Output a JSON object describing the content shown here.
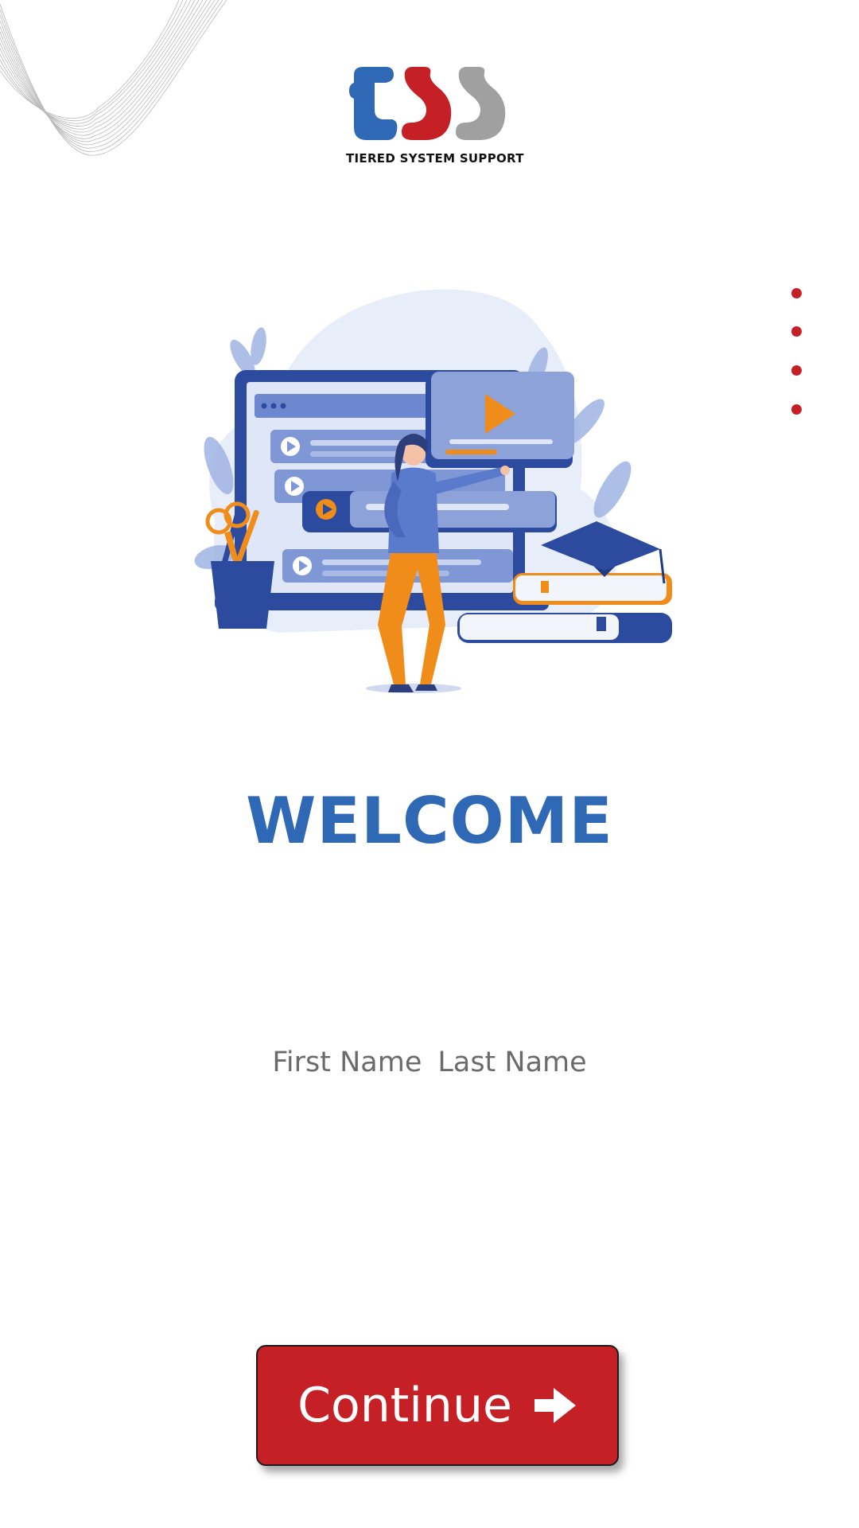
{
  "app": {
    "logo": {
      "letters": "tss",
      "caption": "TIERED SYSTEM SUPPORT",
      "colors": {
        "t": "#2f68b4",
        "s1": "#c62027",
        "s2": "#a0a0a0"
      }
    }
  },
  "pager": {
    "dot_count": 4,
    "dot_color": "#c62027"
  },
  "hero": {
    "icon": "online-learning-illustration",
    "colors": {
      "primary": "#2c4a9e",
      "light": "#7f97d4",
      "accent": "#f08c19",
      "bg": "#e8eef9"
    }
  },
  "welcome": {
    "title": "WELCOME",
    "color": "#2f68b4"
  },
  "user": {
    "first_name": "First Name",
    "last_name": "Last Name",
    "color": "#6b6b6b"
  },
  "continue_button": {
    "label": "Continue",
    "icon": "arrow-right-icon",
    "bg": "#c62027",
    "text_color": "#ffffff"
  }
}
